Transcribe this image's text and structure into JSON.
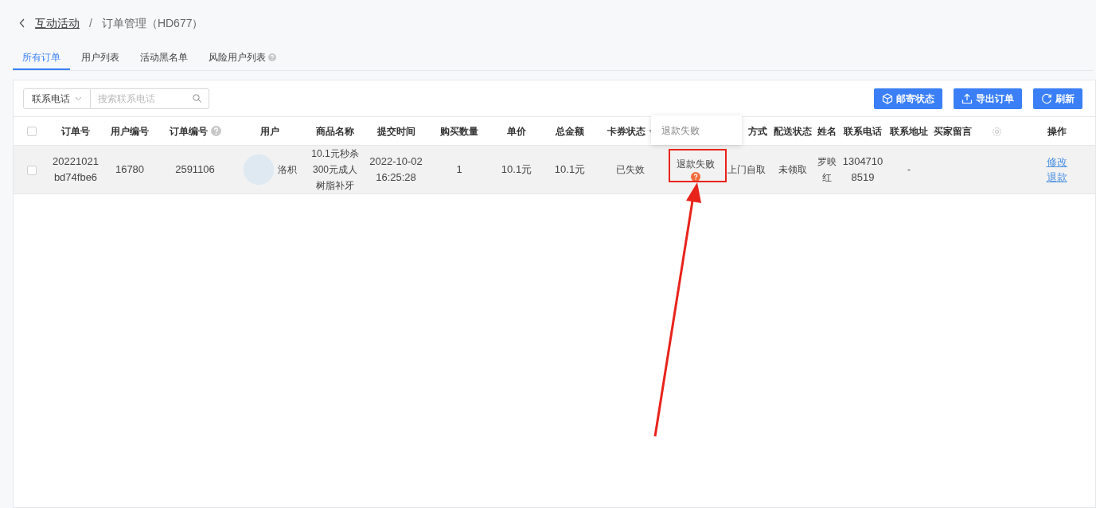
{
  "breadcrumb": {
    "parent": "互动活动",
    "separator": "/",
    "current": "订单管理（HD677）"
  },
  "tabs": [
    {
      "label": "所有订单",
      "selected": true,
      "help": false
    },
    {
      "label": "用户列表",
      "selected": false,
      "help": false
    },
    {
      "label": "活动黑名单",
      "selected": false,
      "help": false
    },
    {
      "label": "风险用户列表",
      "selected": false,
      "help": true
    }
  ],
  "filter": {
    "select": "联系电话",
    "placeholder": "搜索联系电话"
  },
  "buttons": [
    {
      "label": "邮寄状态",
      "kind": "box"
    },
    {
      "label": "导出订单",
      "kind": "upload"
    },
    {
      "label": "刷新",
      "kind": "refresh"
    }
  ],
  "table": {
    "select_all": {
      "checked": false
    },
    "columns": [
      {
        "label": "订单号"
      },
      {
        "label": "用户编号"
      },
      {
        "label": "订单编号",
        "help": true
      },
      {
        "label": "用户"
      },
      {
        "label": "商品名称"
      },
      {
        "label": "提交时间"
      },
      {
        "label": "购买数量"
      },
      {
        "label": "单价"
      },
      {
        "label": "总金额"
      },
      {
        "label": "卡券状态",
        "sortable": true
      },
      {
        "kind": "blank"
      },
      {
        "label": "方式"
      },
      {
        "label": "配送状态"
      },
      {
        "label": "姓名"
      },
      {
        "label": "联系电话"
      },
      {
        "label": "联系地址"
      },
      {
        "label": "买家留言"
      },
      {
        "kind": "settings"
      },
      {
        "label": "操作"
      }
    ],
    "rows": [
      {
        "checked": false,
        "hovered": true,
        "order_no": "20221021bd74fbe6",
        "user_id": "16780",
        "order_id": "2591106",
        "user_name": "洛枳",
        "product": "10.1元秒杀300元成人树脂补牙",
        "submitted": "2022-10-02 16:25:28",
        "quantity": "1",
        "unit_price": "10.1元",
        "total": "10.1元",
        "coupon_status": "已失效",
        "refund_status": "退款失败",
        "refund_help": true,
        "delivery_method": "上门自取",
        "delivery_status": "未领取",
        "name": "罗映红",
        "phone": "13047108519",
        "address": "-",
        "actions": [
          "修改",
          "退款"
        ]
      }
    ]
  },
  "tooltip": {
    "text": "退款失败"
  }
}
